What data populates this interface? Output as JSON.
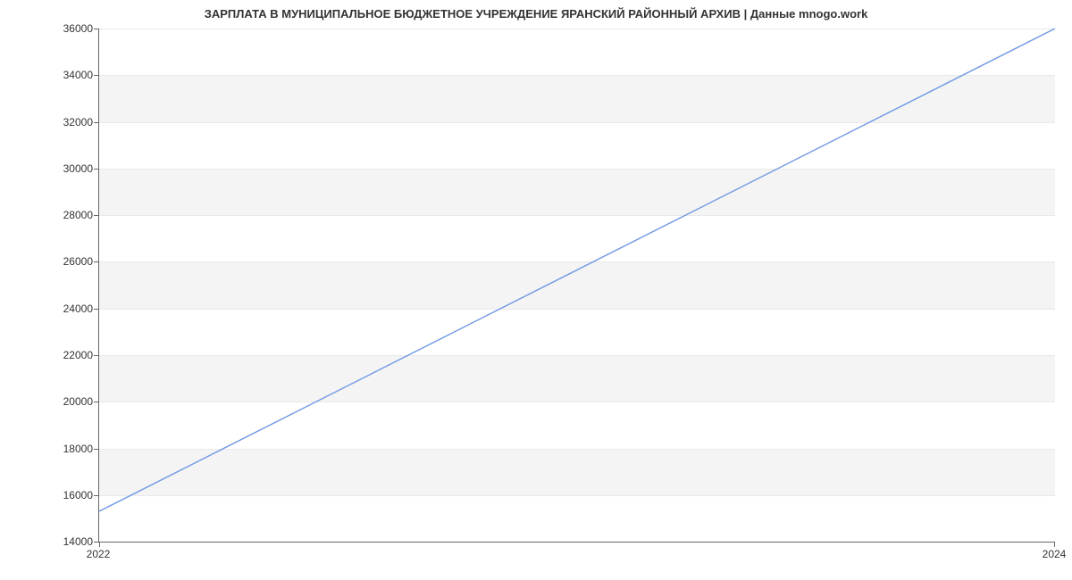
{
  "chart_data": {
    "type": "line",
    "title": "ЗАРПЛАТА В МУНИЦИПАЛЬНОЕ БЮДЖЕТНОЕ УЧРЕЖДЕНИЕ ЯРАНСКИЙ РАЙОННЫЙ АРХИВ | Данные mnogo.work",
    "xlabel": "",
    "ylabel": "",
    "x": [
      2022,
      2024
    ],
    "values": [
      15300,
      36000
    ],
    "x_ticks": [
      2022,
      2024
    ],
    "y_ticks": [
      14000,
      16000,
      18000,
      20000,
      22000,
      24000,
      26000,
      28000,
      30000,
      32000,
      34000,
      36000
    ],
    "xlim": [
      2022,
      2024
    ],
    "ylim": [
      14000,
      36000
    ],
    "line_color": "#6f98e3",
    "grid": true
  }
}
